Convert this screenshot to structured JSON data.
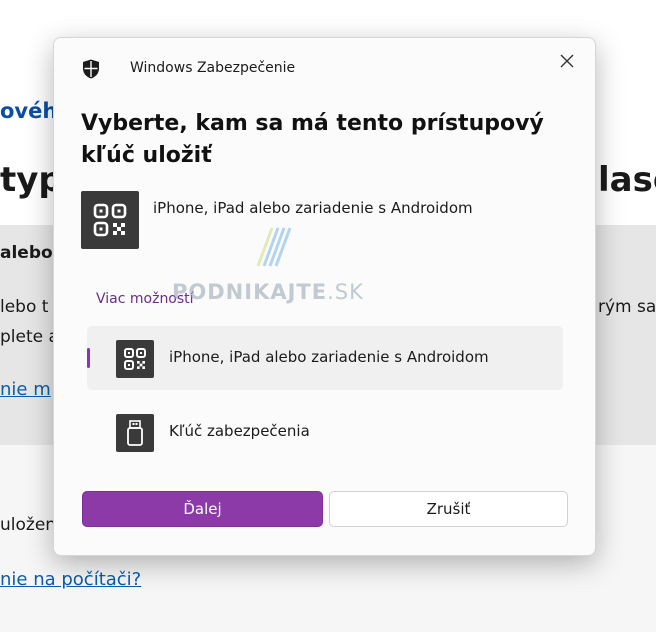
{
  "background": {
    "line1": "ového",
    "line2_left": "typ",
    "line2_right": "lase",
    "line3": "alebo",
    "line4_left": "lebo t",
    "line4_right": "rým sa",
    "line5": "plete a",
    "link1": "nie m",
    "line6": "uložen",
    "link2": "nie na počítači?"
  },
  "dialog": {
    "app_title": "Windows Zabezpečenie",
    "heading": "Vyberte, kam sa má tento prístupový kľúč uložiť",
    "main_option": "iPhone, iPad alebo zariadenie s Androidom",
    "more_options_label": "Viac možností",
    "options": [
      {
        "label": "iPhone, iPad alebo zariadenie s Androidom",
        "icon": "qr-code-icon",
        "selected": true
      },
      {
        "label": "Kľúč zabezpečenia",
        "icon": "usb-key-icon",
        "selected": false
      }
    ],
    "next_button": "Ďalej",
    "cancel_button": "Zrušiť"
  },
  "watermark": {
    "text_main": "PODNIKAJTE",
    "text_suffix": ".SK"
  },
  "colors": {
    "accent": "#8b3aa8",
    "link_purple": "#6a2d8a",
    "background_link": "#0b5cad"
  }
}
